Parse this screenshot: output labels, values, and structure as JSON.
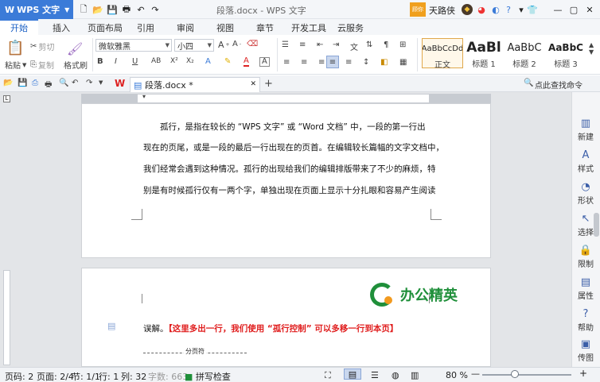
{
  "titlebar": {
    "app_name": "WPS 文字",
    "doc_title": "段落.docx - WPS 文字",
    "tag": "顾你",
    "user": "天路侠"
  },
  "menu": {
    "tabs": [
      "开始",
      "插入",
      "页面布局",
      "引用",
      "审阅",
      "视图",
      "章节",
      "开发工具",
      "云服务"
    ]
  },
  "ribbon": {
    "paste": "粘贴",
    "cut": "剪切",
    "copy": "复制",
    "format_painter": "格式刷",
    "font_name": "微软雅黑",
    "font_size": "小四",
    "styles": [
      {
        "preview": "AaBbCcDd",
        "label": "正文"
      },
      {
        "preview": "AaBl",
        "label": "标题 1"
      },
      {
        "preview": "AaBbC",
        "label": "标题 2"
      },
      {
        "preview": "AaBbC",
        "label": "标题 3"
      }
    ]
  },
  "doctab": {
    "name": "段落.docx *"
  },
  "find_command": "点此查找命令",
  "page1": {
    "lines": [
      "孤行，是指在较长的 “WPS 文字” 或 “Word 文档” 中，一段的第一行出",
      "现在的页尾，或是一段的最后一行出现在的页首。在编辑较长篇幅的文字文档中，",
      "我们经常会遇到这种情况。孤行的出现给我们的编辑排版带来了不少的麻烦，特",
      "别是有时候孤行仅有一两个字，单独出现在页面上显示十分扎眼和容易产生阅读"
    ]
  },
  "page2": {
    "logo_text": "办公精英",
    "line_start": "误解。",
    "line_red": "【这里多出一行，我们使用 “孤行控制” 可以多移一行到本页】",
    "page_break": "分页符"
  },
  "right_panel": [
    "新建",
    "样式",
    "形状",
    "选择",
    "限制",
    "属性",
    "帮助",
    "传图"
  ],
  "status": {
    "page_code": "页码: 2",
    "page": "页面: 2/4",
    "section": "节: 1/1",
    "row": "行: 1",
    "col": "列: 32",
    "words": "字数: 663",
    "spell": "拼写检查",
    "zoom": "80 %"
  },
  "colors": {
    "accent": "#3b7bd8",
    "red_text": "#e01e1e",
    "logo_green": "#1f8f3a"
  }
}
